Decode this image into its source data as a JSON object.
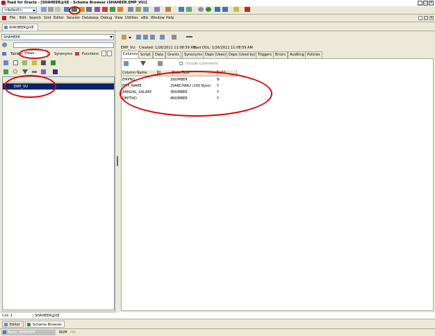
{
  "window": {
    "title": "Toad for Oracle - [SHAHEER@XE - Schema Browser (SHAHEER.EMP_VU)]",
    "controls": [
      "_",
      "□",
      "×"
    ]
  },
  "toolbar": {
    "combo_value": "<default>"
  },
  "menu": {
    "items": [
      "File",
      "Edit",
      "Search",
      "Grid",
      "Editor",
      "Session",
      "Database",
      "Debug",
      "View",
      "Utilities",
      "eBiz",
      "Window",
      "Help"
    ],
    "mdi_controls": [
      "_",
      "□",
      "×"
    ]
  },
  "connection_tab": "SHAHEER@XE",
  "left": {
    "schema_value": "SHAHEER",
    "filter_value": "",
    "object_tabs": [
      "Tables",
      "Views",
      "Synonyms",
      "Functions"
    ],
    "tree_items": [
      "EMP_VU"
    ],
    "status_count": "Cnt: 1",
    "status_conn": "SHAHEER@XE"
  },
  "right": {
    "info_object": "EMP_VU:",
    "info_created": "Created: 1/26/2011 11:08:59 AM",
    "info_ddl": "Last DDL: 1/26/2011 11:08:59 AM",
    "detail_tabs": [
      "Columns",
      "Script",
      "Data",
      "Grants",
      "Synonyms",
      "Deps (Uses)",
      "Deps (Used by)",
      "Triggers",
      "Errors",
      "Auditing",
      "Policies"
    ],
    "include_label": "Include Comments",
    "grid": {
      "headers": [
        "Column Name",
        "ID",
        "Data Type",
        "Null?"
      ],
      "rows": [
        [
          "EMPNO",
          "1",
          "NUMBER",
          "N"
        ],
        [
          "EMP_NAME",
          "2",
          "VARCHAR2 (100 Byte)",
          "Y"
        ],
        [
          "ANNUAL_SALARY",
          "3",
          "NUMBER",
          "Y"
        ],
        [
          "DEPTNO",
          "4",
          "NUMBER",
          "Y"
        ]
      ]
    }
  },
  "taskbar": {
    "tabs": [
      "Editor",
      "Schema Browser"
    ]
  },
  "statusbar": {
    "item": "Table: SHAHEER",
    "num": "NUM",
    "ins": "INS"
  },
  "colors": {
    "selection": "#0a246a",
    "annotation": "#e00000",
    "chrome": "#ece9d8",
    "title": "#0a246a"
  }
}
